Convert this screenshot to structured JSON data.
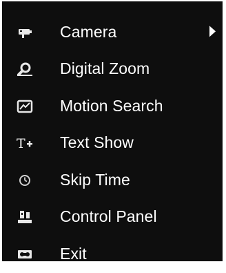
{
  "menu": {
    "items": [
      {
        "label": "Camera",
        "icon": "camera-icon",
        "has_submenu": true
      },
      {
        "label": "Digital Zoom",
        "icon": "magnifier-icon",
        "has_submenu": false
      },
      {
        "label": "Motion Search",
        "icon": "motion-search-icon",
        "has_submenu": false
      },
      {
        "label": "Text Show",
        "icon": "text-show-icon",
        "has_submenu": false
      },
      {
        "label": "Skip Time",
        "icon": "clock-icon",
        "has_submenu": false
      },
      {
        "label": "Control Panel",
        "icon": "control-panel-icon",
        "has_submenu": false
      },
      {
        "label": "Exit",
        "icon": "exit-icon",
        "has_submenu": false
      }
    ]
  },
  "colors": {
    "background": "#0e0e0e",
    "text": "#ffffff",
    "icon": "#e8e8e8"
  }
}
